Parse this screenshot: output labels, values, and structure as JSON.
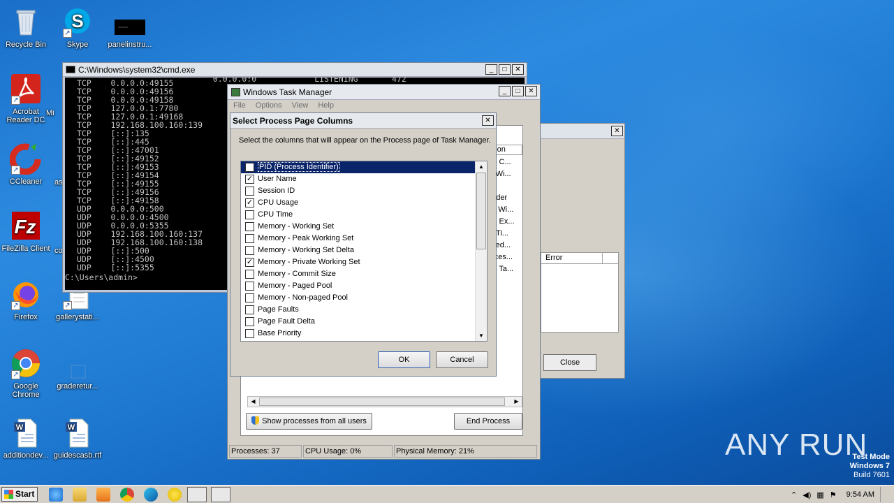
{
  "desktop": {
    "icons": [
      {
        "label": "Recycle Bin"
      },
      {
        "label": "Skype"
      },
      {
        "label": "panelinstru..."
      },
      {
        "label": "Acrobat Reader DC"
      },
      {
        "label": "Mi"
      },
      {
        "label": "CCleaner"
      },
      {
        "label": "as"
      },
      {
        "label": "FileZilla Client"
      },
      {
        "label": "co"
      },
      {
        "label": "Firefox"
      },
      {
        "label": "gallerystati..."
      },
      {
        "label": "Google Chrome"
      },
      {
        "label": "graderetur..."
      },
      {
        "label": "additiondev..."
      },
      {
        "label": "guidescasb.rtf"
      }
    ]
  },
  "cmd": {
    "title": "C:\\Windows\\system32\\cmd.exe",
    "top_partial": "  0.0.0.0:0            LISTENING       472",
    "lines": [
      "TCP    0.0.0.0:49155",
      "TCP    0.0.0.0:49156",
      "TCP    0.0.0.0:49158",
      "TCP    127.0.0.1:7780",
      "TCP    127.0.0.1:49168",
      "TCP    192.168.100.160:139",
      "TCP    [::]:135",
      "TCP    [::]:445",
      "TCP    [::]:47001",
      "TCP    [::]:49152",
      "TCP    [::]:49153",
      "TCP    [::]:49154",
      "TCP    [::]:49155",
      "TCP    [::]:49156",
      "TCP    [::]:49158",
      "UDP    0.0.0.0:500",
      "UDP    0.0.0.0:4500",
      "UDP    0.0.0.0:5355",
      "UDP    192.168.100.160:137",
      "UDP    192.168.100.160:138",
      "UDP    [::]:500",
      "UDP    [::]:4500",
      "UDP    [::]:5355"
    ],
    "prompt": "C:\\Users\\admin>"
  },
  "bg_dialog": {
    "list_header": "Error",
    "close_label": "Close"
  },
  "task_manager": {
    "title": "Windows Task Manager",
    "menu": [
      "File",
      "Options",
      "View",
      "Help"
    ],
    "column_header_peek": "ption",
    "peek_rows": [
      "ws C...",
      "le Wi...",
      "",
      "oader",
      "ap Wi...",
      "ws Ex...",
      "rk Ti...",
      "ched...",
      "roces...",
      "ws Ta..."
    ],
    "show_all_label": "Show processes from all users",
    "end_process_label": "End Process",
    "status": {
      "processes": "Processes: 37",
      "cpu": "CPU Usage: 0%",
      "memory": "Physical Memory: 21%"
    }
  },
  "select_columns": {
    "title": "Select Process Page Columns",
    "description": "Select the columns that will appear on the Process page of Task Manager.",
    "items": [
      {
        "label": "PID (Process Identifier)",
        "checked": false,
        "selected": true
      },
      {
        "label": "User Name",
        "checked": true
      },
      {
        "label": "Session ID",
        "checked": false
      },
      {
        "label": "CPU Usage",
        "checked": true
      },
      {
        "label": "CPU Time",
        "checked": false
      },
      {
        "label": "Memory - Working Set",
        "checked": false
      },
      {
        "label": "Memory - Peak Working Set",
        "checked": false
      },
      {
        "label": "Memory - Working Set Delta",
        "checked": false
      },
      {
        "label": "Memory - Private Working Set",
        "checked": true
      },
      {
        "label": "Memory - Commit Size",
        "checked": false
      },
      {
        "label": "Memory - Paged Pool",
        "checked": false
      },
      {
        "label": "Memory - Non-paged Pool",
        "checked": false
      },
      {
        "label": "Page Faults",
        "checked": false
      },
      {
        "label": "Page Fault Delta",
        "checked": false
      },
      {
        "label": "Base Priority",
        "checked": false
      }
    ],
    "ok_label": "OK",
    "cancel_label": "Cancel"
  },
  "taskbar": {
    "start_label": "Start",
    "clock": "9:54 AM"
  },
  "watermark": {
    "text": "ANY RUN",
    "line1": "Test Mode",
    "line2": "Windows 7",
    "line3": "Build 7601"
  }
}
